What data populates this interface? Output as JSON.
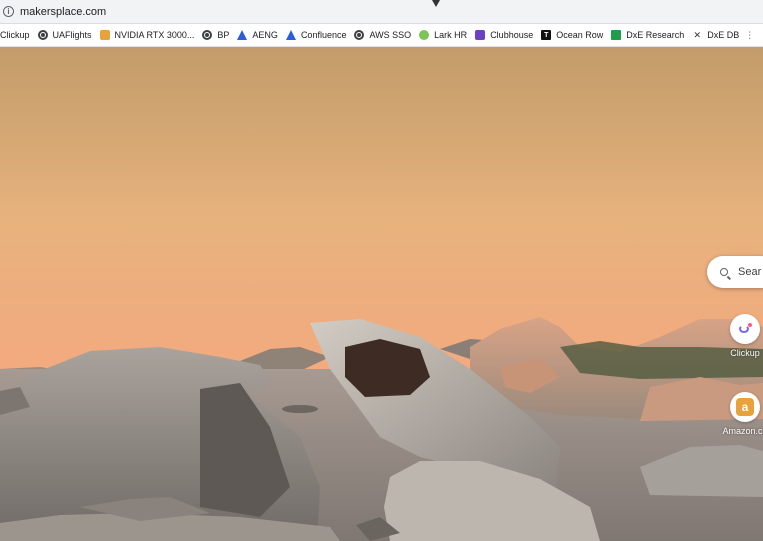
{
  "address_bar": {
    "url": "makersplace.com",
    "info_icon": "info-icon"
  },
  "bookmarks": [
    {
      "label": "Clickup",
      "icon": "clickup-icon"
    },
    {
      "label": "UAFlights",
      "icon": "globe-icon"
    },
    {
      "label": "NVIDIA RTX 3000...",
      "icon": "amazon-icon"
    },
    {
      "label": "BP",
      "icon": "globe-icon"
    },
    {
      "label": "AENG",
      "icon": "atlassian-icon"
    },
    {
      "label": "Confluence",
      "icon": "confluence-icon"
    },
    {
      "label": "AWS SSO",
      "icon": "globe-icon"
    },
    {
      "label": "Lark HR",
      "icon": "lark-icon"
    },
    {
      "label": "Clubhouse",
      "icon": "clubhouse-icon"
    },
    {
      "label": "Ocean Row",
      "icon": "ocean-row-icon"
    },
    {
      "label": "DxE Research",
      "icon": "sheets-icon"
    },
    {
      "label": "DxE DB",
      "icon": "dxdb-icon"
    }
  ],
  "new_tab": {
    "search_placeholder": "Sear",
    "shortcuts": [
      {
        "label": "Clickup",
        "icon": "clickup-icon"
      },
      {
        "label": "Amazon.co",
        "icon": "amazon-icon",
        "glyph": "a"
      }
    ]
  },
  "colors": {
    "sky_top": "#c9a06a",
    "sky_mid": "#e9b07a",
    "sky_horizon": "#f0a37a",
    "rock": "#b9b3ac",
    "water": "#9a8e86"
  }
}
